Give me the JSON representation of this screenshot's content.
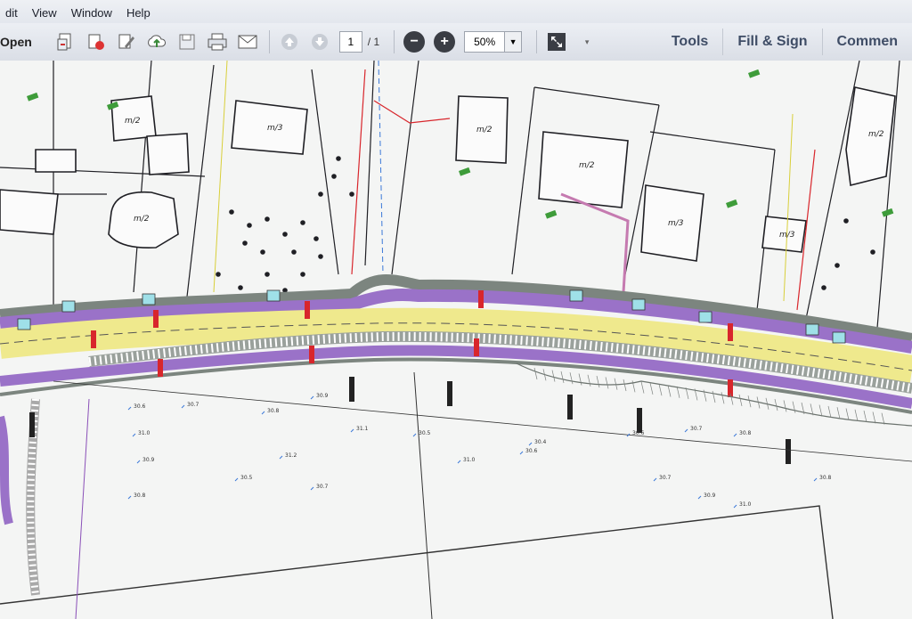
{
  "menubar": {
    "items": [
      {
        "label": "dit"
      },
      {
        "label": "View"
      },
      {
        "label": "Window"
      },
      {
        "label": "Help"
      }
    ]
  },
  "toolbar": {
    "open_label": "Open",
    "icons": [
      "create-pdf-icon",
      "print-export-icon",
      "edit-icon",
      "upload-cloud-icon",
      "save-icon",
      "print-icon",
      "email-icon"
    ],
    "page_current": "1",
    "page_total": "/ 1",
    "zoom_value": "50%",
    "right_tools": [
      {
        "label": "Tools"
      },
      {
        "label": "Fill & Sign"
      },
      {
        "label": "Commen"
      }
    ]
  },
  "drawing": {
    "lot_labels": [
      "m/2",
      "m/3",
      "m/2",
      "m/2",
      "m/3",
      "m/3",
      "m/2",
      "m/2"
    ],
    "elevation_labels": [
      "30.6",
      "30.7",
      "30.8",
      "30.9",
      "31.0",
      "31.1",
      "30.5",
      "30.4",
      "30.6",
      "30.7",
      "30.8",
      "30.9",
      "31.2",
      "31.0",
      "30.5",
      "30.7",
      "30.8"
    ],
    "colors": {
      "road_yellow": "#efe98d",
      "road_purple": "#9a72c8",
      "curb_gray": "#7c857f",
      "line_black": "#1f1f24",
      "utility_red": "#d8262c",
      "utility_blue": "#3a78d8",
      "utility_green": "#3e9c3a"
    }
  }
}
